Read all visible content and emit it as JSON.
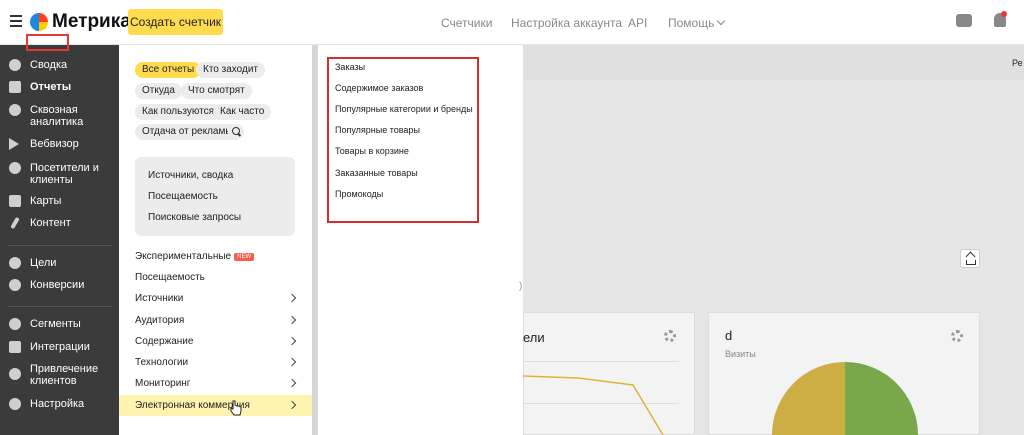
{
  "header": {
    "logo": "Метрика",
    "create_button": "Создать счетчик",
    "nav": [
      "Счетчики",
      "Настройка аккаунта",
      "API",
      "Помощь"
    ],
    "icons": [
      "menu-icon",
      "chat-icon",
      "bell-icon"
    ]
  },
  "sidebar": {
    "items": [
      {
        "label": "Сводка",
        "icon": "dashboard-icon"
      },
      {
        "label": "Отчеты",
        "icon": "reports-icon"
      },
      {
        "label": "Сквозная аналитика",
        "icon": "analytics-icon"
      },
      {
        "label": "Вебвизор",
        "icon": "play-icon"
      },
      {
        "label": "Посетители и клиенты",
        "icon": "user-icon"
      },
      {
        "label": "Карты",
        "icon": "map-icon"
      },
      {
        "label": "Контент",
        "icon": "pencil-icon"
      },
      {
        "label": "Цели",
        "icon": "target-icon"
      },
      {
        "label": "Конверсии",
        "icon": "conversion-icon"
      },
      {
        "label": "Сегменты",
        "icon": "pie-icon"
      },
      {
        "label": "Интеграции",
        "icon": "puzzle-icon"
      },
      {
        "label": "Привлечение клиентов",
        "icon": "fire-icon"
      },
      {
        "label": "Настройка",
        "icon": "gear-icon"
      }
    ]
  },
  "reports_menu": {
    "filters": [
      "Все отчеты",
      "Кто заходит",
      "Откуда",
      "Что смотрят",
      "Как пользуются",
      "Как часто",
      "Отдача от рекламы"
    ],
    "quick_links": [
      "Источники, сводка",
      "Посещаемость",
      "Поисковые запросы"
    ],
    "sections": [
      "Экспериментальные",
      "Посещаемость",
      "Источники",
      "Аудитория",
      "Содержание",
      "Технологии",
      "Мониторинг",
      "Электронная коммерция"
    ],
    "new_badge": "NEW"
  },
  "submenu": {
    "items": [
      "Заказы",
      "Содержимое заказов",
      "Популярные категории и бренды",
      "Популярные товары",
      "Товары в корзине",
      "Заказанные товары",
      "Промокоды"
    ]
  },
  "main": {
    "header_text": "Ре",
    "paren_text": ")",
    "card1_title": "ели",
    "card2_title": "d",
    "card2_subtitle": "Визиты"
  },
  "colors": {
    "accent": "#ffdb4d",
    "sidebar": "#3b3b3b",
    "highlight_box": "#d32f2f",
    "pie_green": "#79a84a",
    "pie_yellow": "#cdae45",
    "line_yellow": "#e0b43a"
  }
}
